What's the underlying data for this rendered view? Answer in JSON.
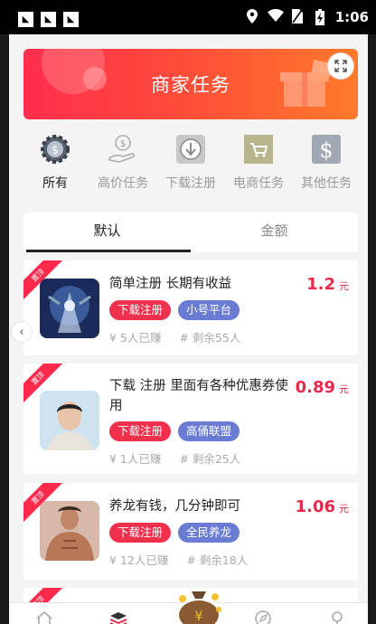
{
  "status": {
    "time": "1:06"
  },
  "banner": {
    "title": "商家任务"
  },
  "categories": [
    {
      "label": "所有",
      "icon": "gear-dollar-icon"
    },
    {
      "label": "高价任务",
      "icon": "hand-coin-icon"
    },
    {
      "label": "下载注册",
      "icon": "download-icon"
    },
    {
      "label": "电商任务",
      "icon": "shopping-cart-icon"
    },
    {
      "label": "其他任务",
      "icon": "dollar-icon"
    }
  ],
  "tabs": [
    {
      "label": "默认"
    },
    {
      "label": "金额"
    }
  ],
  "tasks": [
    {
      "badge": "置顶",
      "title": "简单注册 长期有收益",
      "price": "1.2",
      "unit": "元",
      "tags": [
        "下载注册",
        "小号平台"
      ],
      "earned": "¥ 5人已赚",
      "remaining": "# 剩余55人"
    },
    {
      "badge": "置顶",
      "title": "下载 注册 里面有各种优惠券使用",
      "price": "0.89",
      "unit": "元",
      "tags": [
        "下载注册",
        "高俑联盟"
      ],
      "earned": "¥ 1人已赚",
      "remaining": "# 剩余25人"
    },
    {
      "badge": "置顶",
      "title": "养龙有钱，几分钟即可",
      "price": "1.06",
      "unit": "元",
      "tags": [
        "下载注册",
        "全民养龙"
      ],
      "earned": "¥ 12人已赚",
      "remaining": "# 剩余18人"
    },
    {
      "badge": "置顶"
    }
  ],
  "colors": {
    "accent": "#e8294a",
    "tag_red": "#f0304d",
    "tag_purple": "#6a7bd4"
  }
}
